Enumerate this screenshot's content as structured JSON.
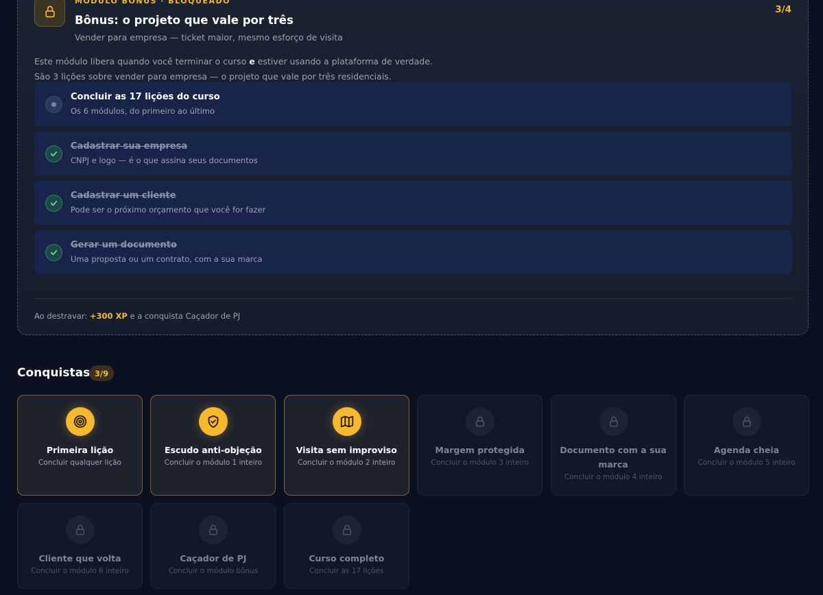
{
  "bonus_module": {
    "eyebrow": "MÓDULO BÔNUS · BLOQUEADO",
    "title": "Bônus: o projeto que vale por três",
    "subtitle": "Vender para empresa — ticket maior, mesmo esforço de visita",
    "progress": "3/4",
    "description_pre": "Este módulo libera quando você terminar o curso ",
    "description_bold": "e",
    "description_post": " estiver usando a plataforma de verdade. São 3 lições sobre vender para empresa — o projeto que vale por três residenciais.",
    "tasks": [
      {
        "title": "Concluir as 17 lições do curso",
        "subtitle": "Os 6 módulos, do primeiro ao último",
        "done": false
      },
      {
        "title": "Cadastrar sua empresa",
        "subtitle": "CNPJ e logo — é o que assina seus documentos",
        "done": true
      },
      {
        "title": "Cadastrar um cliente",
        "subtitle": "Pode ser o próximo orçamento que você for fazer",
        "done": true
      },
      {
        "title": "Gerar um documento",
        "subtitle": "Uma proposta ou um contrato, com a sua marca",
        "done": true
      }
    ],
    "reward_pre": "Ao destravar: ",
    "reward_xp": "+300 XP",
    "reward_post": " e a conquista Caçador de PJ"
  },
  "achievements": {
    "title": "Conquistas",
    "count": "3/9",
    "items": [
      {
        "title": "Primeira lição",
        "subtitle": "Concluir qualquer lição",
        "unlocked": true,
        "icon": "target-icon"
      },
      {
        "title": "Escudo anti-objeção",
        "subtitle": "Concluir o módulo 1 inteiro",
        "unlocked": true,
        "icon": "shield-icon"
      },
      {
        "title": "Visita sem improviso",
        "subtitle": "Concluir o módulo 2 inteiro",
        "unlocked": true,
        "icon": "map-icon"
      },
      {
        "title": "Margem protegida",
        "subtitle": "Concluir o módulo 3 inteiro",
        "unlocked": false,
        "icon": "lock-icon"
      },
      {
        "title": "Documento com a sua marca",
        "subtitle": "Concluir o módulo 4 inteiro",
        "unlocked": false,
        "icon": "lock-icon"
      },
      {
        "title": "Agenda cheia",
        "subtitle": "Concluir o módulo 5 inteiro",
        "unlocked": false,
        "icon": "lock-icon"
      },
      {
        "title": "Cliente que volta",
        "subtitle": "Concluir o módulo 6 inteiro",
        "unlocked": false,
        "icon": "lock-icon"
      },
      {
        "title": "Caçador de PJ",
        "subtitle": "Concluir o módulo bônus",
        "unlocked": false,
        "icon": "lock-icon"
      },
      {
        "title": "Curso completo",
        "subtitle": "Concluir as 17 lições",
        "unlocked": false,
        "icon": "lock-icon"
      }
    ]
  },
  "colors": {
    "accent": "#f5b82e",
    "background": "#0b1120",
    "success": "#2f8066"
  }
}
